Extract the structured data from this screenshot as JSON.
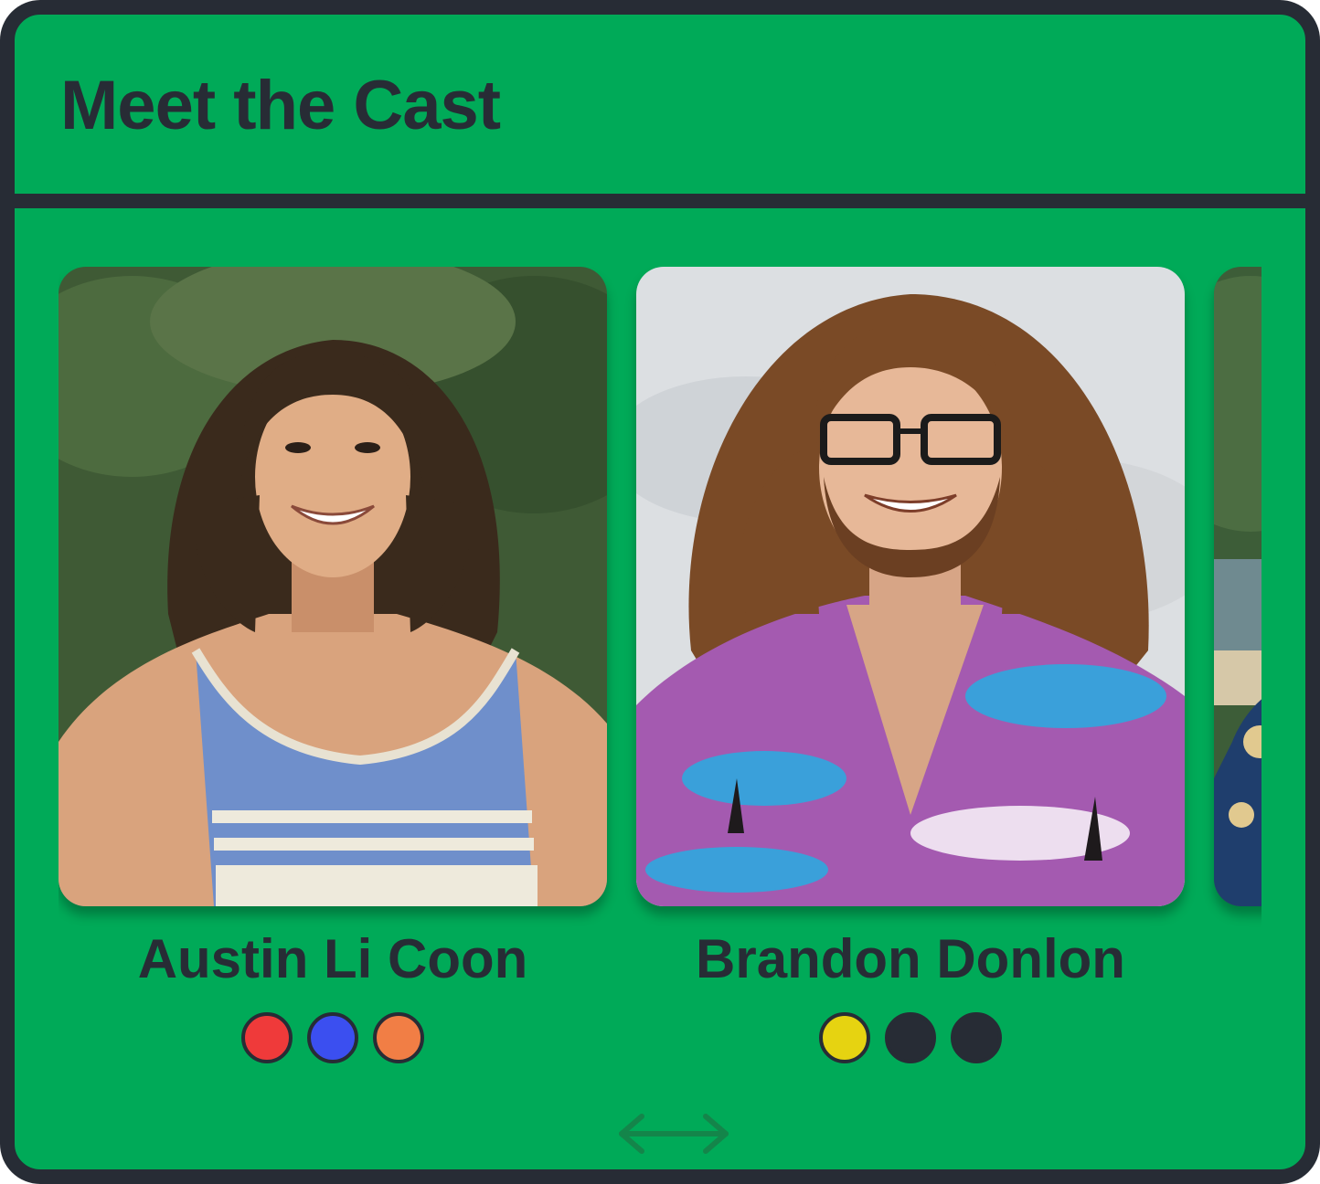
{
  "header": {
    "title": "Meet the Cast"
  },
  "cast": [
    {
      "name": "Austin Li Coon",
      "photo_icon": "contestant-portrait-icon",
      "tribe_colors": [
        "#ef3a3a",
        "#3b4ff0",
        "#f17e45"
      ]
    },
    {
      "name": "Brandon Donlon",
      "photo_icon": "contestant-portrait-icon",
      "tribe_colors": [
        "#e6d311",
        "#272c35",
        "#272c35"
      ]
    },
    {
      "name": "",
      "photo_icon": "contestant-portrait-icon",
      "tribe_colors": []
    }
  ],
  "scroll_hint_icon": "horizontal-scroll-arrow-icon",
  "colors": {
    "background": "#00aa58",
    "ink": "#272c35"
  }
}
